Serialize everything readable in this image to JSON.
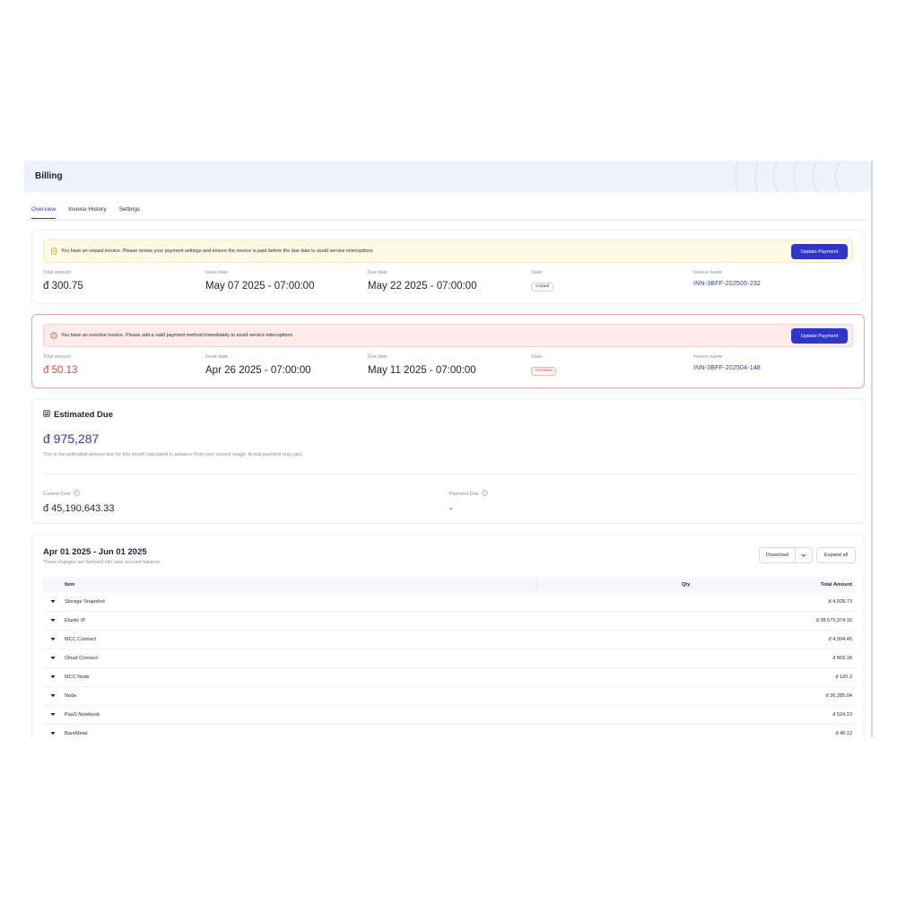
{
  "header": {
    "title": "Billing"
  },
  "tabs": [
    {
      "label": "Overview",
      "active": true
    },
    {
      "label": "Invoice History",
      "active": false
    },
    {
      "label": "Settings",
      "active": false
    }
  ],
  "unpaid_invoice": {
    "banner_text": "You have an unpaid invoice. Please review your payment settings and ensure the invoice is paid before the due date to avoid service interruptions",
    "button_label": "Update Payment",
    "total_amount_label": "Total amount",
    "total_amount": "đ 300.75",
    "issue_date_label": "Issue date",
    "issue_date": "May 07 2025 - 07:00:00",
    "due_date_label": "Due date",
    "due_date": "May 22 2025 - 07:00:00",
    "state_label": "State",
    "state": "Unpaid",
    "invoice_name_label": "Invoice name",
    "invoice_name": "INN-3BFF-202505-232"
  },
  "overdue_invoice": {
    "banner_text": "You have an overdue invoice. Please add a valid payment method immediately to avoid service interruptions",
    "button_label": "Update Payment",
    "total_amount_label": "Total amount",
    "total_amount": "đ 50.13",
    "issue_date_label": "Issue date",
    "issue_date": "Apr 26 2025 - 07:00:00",
    "due_date_label": "Due date",
    "due_date": "May 11 2025 - 07:00:00",
    "state_label": "State",
    "state": "Overdue",
    "invoice_name_label": "Invoice name",
    "invoice_name": "INN-3BFF-202504-148"
  },
  "estimated_due": {
    "title": "Estimated Due",
    "amount": "đ 975,287",
    "description": "This is the estimated amount due for this month calculated in advance from your current usage. Actual payment may vary.",
    "current_cost_label": "Current Cost",
    "current_cost": "đ 45,190,643.33",
    "payment_due_label": "Payment Due",
    "payment_due": "-"
  },
  "period": {
    "title": "Apr 01 2025 - Jun 01 2025",
    "subtitle": "These changes are factored into your account balance.",
    "download_label": "Download",
    "expand_label": "Expand all",
    "columns": {
      "item": "Item",
      "qty": "Qty",
      "total": "Total Amount"
    },
    "rows": [
      {
        "name": "Storage Snapshot",
        "total": "đ 4,928.73"
      },
      {
        "name": "Elastic IP",
        "total": "đ 38,573,374.16"
      },
      {
        "name": "MCC Connect",
        "total": "đ 4,994.45"
      },
      {
        "name": "Cloud Connect",
        "total": "đ 869.18"
      },
      {
        "name": "MCC Node",
        "total": "đ 120.3"
      },
      {
        "name": "Node",
        "total": "đ 36,285.04"
      },
      {
        "name": "PaaS Notebook",
        "total": "đ 524.23"
      },
      {
        "name": "BareMetal",
        "total": "đ 48.12"
      }
    ]
  },
  "colors": {
    "primary": "#2f35c6",
    "danger": "#e0473c",
    "header_bg": "#eef2fb",
    "warning_bg": "#fdfae5",
    "danger_bg": "#fdecea"
  }
}
